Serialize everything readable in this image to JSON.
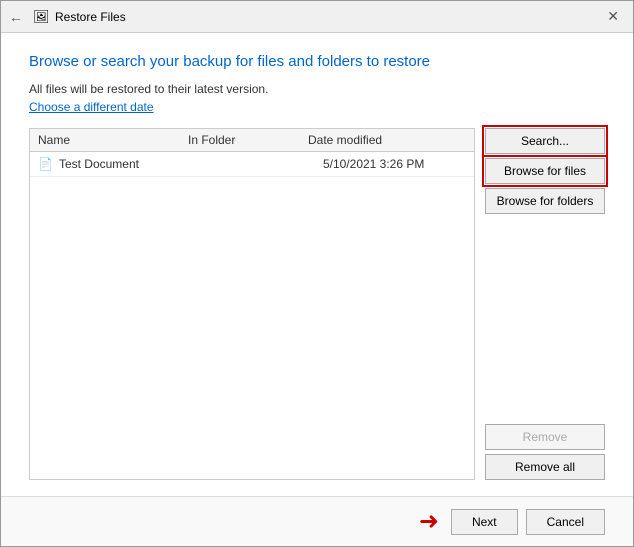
{
  "window": {
    "title": "Restore Files",
    "close_label": "✕"
  },
  "header": {
    "back_icon": "←",
    "title_icon": "🖼",
    "heading": "Browse or search your backup for files and folders to restore",
    "info_text": "All files will be restored to their latest version.",
    "link_text": "Choose a different date"
  },
  "file_list": {
    "columns": {
      "name": "Name",
      "in_folder": "In Folder",
      "date_modified": "Date modified"
    },
    "rows": [
      {
        "icon": "📄",
        "name": "Test Document",
        "folder": "",
        "date": "5/10/2021 3:26 PM"
      }
    ]
  },
  "buttons": {
    "search": "Search...",
    "browse_files": "Browse for files",
    "browse_folders": "Browse for folders",
    "remove": "Remove",
    "remove_all": "Remove all"
  },
  "footer": {
    "next": "Next",
    "cancel": "Cancel",
    "arrow": "➜"
  }
}
